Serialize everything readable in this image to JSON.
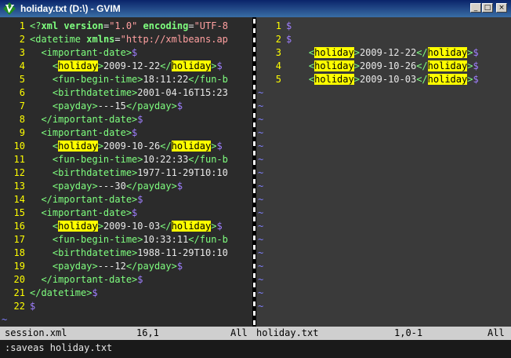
{
  "window": {
    "title": "holiday.txt (D:\\) - GVIM",
    "icon": "vim-icon",
    "controls": {
      "minimize": "_",
      "maximize": "□",
      "close": "×"
    }
  },
  "left_pane": {
    "lines": [
      {
        "n": "1",
        "segs": [
          [
            "tag",
            "<?"
          ],
          [
            "attr",
            "xml"
          ],
          [
            "txt",
            " "
          ],
          [
            "attr",
            "version"
          ],
          [
            "txt",
            "="
          ],
          [
            "str",
            "\"1.0\""
          ],
          [
            "txt",
            " "
          ],
          [
            "attr",
            "encoding"
          ],
          [
            "txt",
            "="
          ],
          [
            "str",
            "\"UTF-8"
          ]
        ]
      },
      {
        "n": "2",
        "segs": [
          [
            "tag",
            "<"
          ],
          [
            "tag",
            "datetime"
          ],
          [
            "txt",
            " "
          ],
          [
            "attr",
            "xmlns"
          ],
          [
            "txt",
            "="
          ],
          [
            "str",
            "\"http://xmlbeans.ap"
          ]
        ]
      },
      {
        "n": "3",
        "segs": [
          [
            "txt",
            "  "
          ],
          [
            "tag",
            "<important-date>"
          ],
          [
            "dollar",
            "$"
          ]
        ]
      },
      {
        "n": "4",
        "segs": [
          [
            "txt",
            "    "
          ],
          [
            "tag",
            "<"
          ],
          [
            "hl",
            "holiday"
          ],
          [
            "tag",
            ">"
          ],
          [
            "txt",
            "2009-12-22"
          ],
          [
            "tag",
            "</"
          ],
          [
            "hl",
            "holiday"
          ],
          [
            "tag",
            ">"
          ],
          [
            "dollar",
            "$"
          ]
        ]
      },
      {
        "n": "5",
        "segs": [
          [
            "txt",
            "    "
          ],
          [
            "tag",
            "<fun-begin-time>"
          ],
          [
            "txt",
            "18:11:22"
          ],
          [
            "tag",
            "</fun-b"
          ]
        ]
      },
      {
        "n": "6",
        "segs": [
          [
            "txt",
            "    "
          ],
          [
            "tag",
            "<birthdatetime>"
          ],
          [
            "txt",
            "2001-04-16T15:23"
          ]
        ]
      },
      {
        "n": "7",
        "segs": [
          [
            "txt",
            "    "
          ],
          [
            "tag",
            "<payday>"
          ],
          [
            "txt",
            "---15"
          ],
          [
            "tag",
            "</payday>"
          ],
          [
            "dollar",
            "$"
          ]
        ]
      },
      {
        "n": "8",
        "segs": [
          [
            "txt",
            "  "
          ],
          [
            "tag",
            "</important-date>"
          ],
          [
            "dollar",
            "$"
          ]
        ]
      },
      {
        "n": "9",
        "segs": [
          [
            "txt",
            "  "
          ],
          [
            "tag",
            "<important-date>"
          ],
          [
            "dollar",
            "$"
          ]
        ]
      },
      {
        "n": "10",
        "segs": [
          [
            "txt",
            "    "
          ],
          [
            "tag",
            "<"
          ],
          [
            "hl",
            "holiday"
          ],
          [
            "tag",
            ">"
          ],
          [
            "txt",
            "2009-10-26"
          ],
          [
            "tag",
            "</"
          ],
          [
            "hl",
            "holiday"
          ],
          [
            "tag",
            ">"
          ],
          [
            "dollar",
            "$"
          ]
        ]
      },
      {
        "n": "11",
        "segs": [
          [
            "txt",
            "    "
          ],
          [
            "tag",
            "<fun-begin-time>"
          ],
          [
            "txt",
            "10:22:33"
          ],
          [
            "tag",
            "</fun-b"
          ]
        ]
      },
      {
        "n": "12",
        "segs": [
          [
            "txt",
            "    "
          ],
          [
            "tag",
            "<birthdatetime>"
          ],
          [
            "txt",
            "1977-11-29T10:10"
          ]
        ]
      },
      {
        "n": "13",
        "segs": [
          [
            "txt",
            "    "
          ],
          [
            "tag",
            "<payday>"
          ],
          [
            "txt",
            "---30"
          ],
          [
            "tag",
            "</payday>"
          ],
          [
            "dollar",
            "$"
          ]
        ]
      },
      {
        "n": "14",
        "segs": [
          [
            "txt",
            "  "
          ],
          [
            "tag",
            "</important-date>"
          ],
          [
            "dollar",
            "$"
          ]
        ]
      },
      {
        "n": "15",
        "segs": [
          [
            "txt",
            "  "
          ],
          [
            "tag",
            "<important-date>"
          ],
          [
            "dollar",
            "$"
          ]
        ]
      },
      {
        "n": "16",
        "segs": [
          [
            "txt",
            "    "
          ],
          [
            "tag",
            "<"
          ],
          [
            "hl",
            "holiday"
          ],
          [
            "tag",
            ">"
          ],
          [
            "txt",
            "2009-10-03"
          ],
          [
            "tag",
            "</"
          ],
          [
            "hl",
            "holiday"
          ],
          [
            "tag",
            ">"
          ],
          [
            "dollar",
            "$"
          ]
        ]
      },
      {
        "n": "17",
        "segs": [
          [
            "txt",
            "    "
          ],
          [
            "tag",
            "<fun-begin-time>"
          ],
          [
            "txt",
            "10:33:11"
          ],
          [
            "tag",
            "</fun-b"
          ]
        ]
      },
      {
        "n": "18",
        "segs": [
          [
            "txt",
            "    "
          ],
          [
            "tag",
            "<birthdatetime>"
          ],
          [
            "txt",
            "1988-11-29T10:10"
          ]
        ]
      },
      {
        "n": "19",
        "segs": [
          [
            "txt",
            "    "
          ],
          [
            "tag",
            "<payday>"
          ],
          [
            "txt",
            "---12"
          ],
          [
            "tag",
            "</payday>"
          ],
          [
            "dollar",
            "$"
          ]
        ]
      },
      {
        "n": "20",
        "segs": [
          [
            "txt",
            "  "
          ],
          [
            "tag",
            "</important-date>"
          ],
          [
            "dollar",
            "$"
          ]
        ]
      },
      {
        "n": "21",
        "segs": [
          [
            "tag",
            "</datetime>"
          ],
          [
            "dollar",
            "$"
          ]
        ]
      },
      {
        "n": "22",
        "segs": [
          [
            "dollar",
            "$"
          ]
        ]
      }
    ],
    "filler": [
      "~"
    ]
  },
  "right_pane": {
    "lines": [
      {
        "n": "1",
        "segs": [
          [
            "dollar",
            "$"
          ]
        ]
      },
      {
        "n": "2",
        "segs": [
          [
            "dollar",
            "$"
          ]
        ]
      },
      {
        "n": "3",
        "segs": [
          [
            "txt",
            "    "
          ],
          [
            "tag",
            "<"
          ],
          [
            "hl",
            "holiday"
          ],
          [
            "tag",
            ">"
          ],
          [
            "txt",
            "2009-12-22"
          ],
          [
            "tag",
            "</"
          ],
          [
            "hl",
            "holiday"
          ],
          [
            "tag",
            ">"
          ],
          [
            "dollar",
            "$"
          ]
        ]
      },
      {
        "n": "4",
        "segs": [
          [
            "txt",
            "    "
          ],
          [
            "tag",
            "<"
          ],
          [
            "hl",
            "holiday"
          ],
          [
            "tag",
            ">"
          ],
          [
            "txt",
            "2009-10-26"
          ],
          [
            "tag",
            "</"
          ],
          [
            "hl",
            "holiday"
          ],
          [
            "tag",
            ">"
          ],
          [
            "dollar",
            "$"
          ]
        ]
      },
      {
        "n": "5",
        "segs": [
          [
            "txt",
            "    "
          ],
          [
            "tag",
            "<"
          ],
          [
            "hl",
            "holiday"
          ],
          [
            "tag",
            ">"
          ],
          [
            "txt",
            "2009-10-03"
          ],
          [
            "tag",
            "</"
          ],
          [
            "hl",
            "holiday"
          ],
          [
            "tag",
            ">"
          ],
          [
            "dollar",
            "$"
          ]
        ]
      }
    ],
    "filler": [
      "~",
      "~",
      "~",
      "~",
      "~",
      "~",
      "~",
      "~",
      "~",
      "~",
      "~",
      "~",
      "~",
      "~",
      "~",
      "~",
      "~"
    ]
  },
  "status": {
    "left_file": "session.xml",
    "left_pos": "16,1",
    "left_scroll": "All",
    "right_file": "holiday.txt",
    "right_pos": "1,0-1",
    "right_scroll": "All"
  },
  "cmdline": ":saveas holiday.txt"
}
